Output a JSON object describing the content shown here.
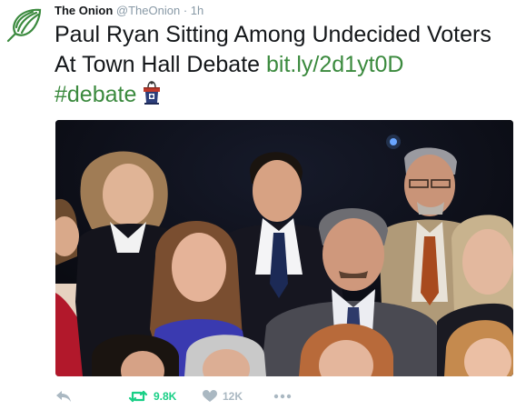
{
  "tweet": {
    "author_name": "The Onion",
    "author_handle": "@TheOnion",
    "separator": "·",
    "time": "1h",
    "text": "Paul Ryan Sitting Among Undecided Voters At Town Hall Debate",
    "link": "bit.ly/2d1yt0D",
    "hashtag": "#debate",
    "emoji": "podium-emoji"
  },
  "actions": {
    "reply_icon": "reply-icon",
    "retweet_icon": "retweet-icon",
    "retweet_count": "9.8K",
    "like_icon": "heart-icon",
    "like_count": "12K",
    "more_icon": "more-icon"
  },
  "colors": {
    "brand_green": "#3b8a3e",
    "retweet_active": "#19cf86",
    "muted": "#8899a6"
  }
}
